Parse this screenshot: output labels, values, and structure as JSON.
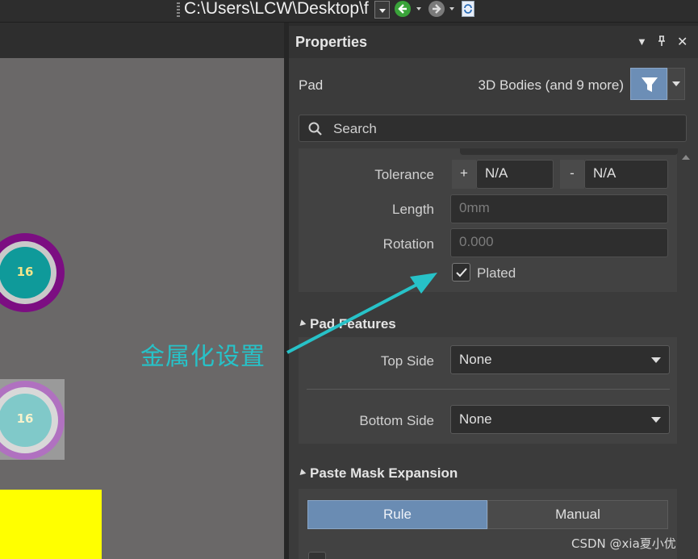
{
  "toolbar": {
    "path": "C:\\Users\\LCW\\Desktop\\f",
    "icons": [
      "back-arrow-icon",
      "forward-arrow-icon",
      "refresh-icon"
    ]
  },
  "canvas": {
    "pad_top_number": "16",
    "pad_bottom_number": "16",
    "colors": {
      "background": "#6a6868",
      "pad_outer": "#7c0e82",
      "pad_core": "#0f9a9a",
      "highlight": "#ffff00"
    }
  },
  "panel": {
    "title": "Properties",
    "object_type": "Pad",
    "filter_summary": "3D Bodies (and 9 more)",
    "search_placeholder": "Search",
    "hole": {
      "tolerance_label": "Tolerance",
      "plus": "+",
      "minus": "-",
      "tolerance_plus": "N/A",
      "tolerance_minus": "N/A",
      "length_label": "Length",
      "length_value": "0mm",
      "rotation_label": "Rotation",
      "rotation_value": "0.000",
      "plated_label": "Plated",
      "plated_checked": true
    },
    "pad_features": {
      "heading": "Pad Features",
      "top_side_label": "Top Side",
      "top_side_value": "None",
      "bottom_side_label": "Bottom Side",
      "bottom_side_value": "None"
    },
    "paste_mask": {
      "heading": "Paste Mask Expansion",
      "rule_label": "Rule",
      "manual_label": "Manual",
      "selected": "Rule"
    }
  },
  "annotation": {
    "text": "金属化设置",
    "color": "#27c2c8"
  },
  "watermark": "CSDN @xia夏小优"
}
